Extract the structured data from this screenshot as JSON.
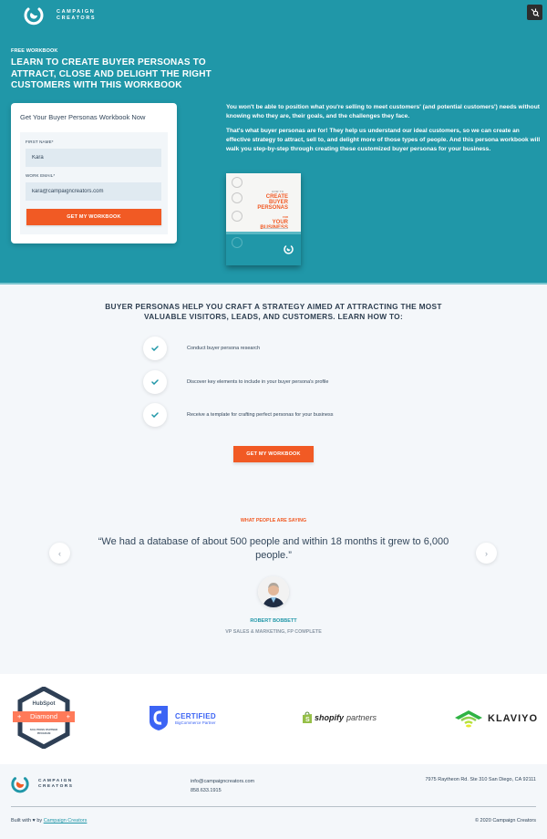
{
  "header": {
    "brand_line1": "CAMPAIGN",
    "brand_line2": "CREATORS",
    "hubspot_badge_icon": "hubspot-sprocket-icon"
  },
  "hero": {
    "eyebrow": "FREE WORKBOOK",
    "title": "LEARN TO CREATE BUYER PERSONAS TO ATTRACT, CLOSE AND DELIGHT THE RIGHT CUSTOMERS WITH THIS WORKBOOK",
    "paragraphs": [
      "You won't be able to position what you're selling to meet customers' (and potential customers') needs without knowing who they are, their goals, and the challenges they face.",
      "That's what buyer personas are for! They help us understand our ideal customers, so we can create an effective strategy to attract, sell to, and delight more of those types of people. And this persona workbook will walk you step-by-step through creating these customized buyer personas for your business."
    ],
    "book": {
      "how_to": "HOW TO",
      "line1": "CREATE",
      "line2": "BUYER",
      "line3": "PERSONAS",
      "for": "FOR",
      "line4": "YOUR",
      "line5": "BUSINESS"
    }
  },
  "form": {
    "title": "Get Your Buyer Personas Workbook Now",
    "first_name_label": "FIRST NAME*",
    "first_name_value": "Kara",
    "email_label": "WORK EMAIL*",
    "email_value": "kara@campaigncreators.com",
    "submit_label": "GET MY WORKBOOK"
  },
  "benefits": {
    "title": "BUYER PERSONAS HELP YOU CRAFT A STRATEGY AIMED AT ATTRACTING THE MOST VALUABLE VISITORS, LEADS, AND CUSTOMERS. LEARN HOW TO:",
    "items": [
      "Conduct buyer persona research",
      "Discover key elements to include in your buyer persona's profile",
      "Receive a template for crafting perfect personas for your business"
    ],
    "cta_label": "GET MY WORKBOOK"
  },
  "testimonial": {
    "eyebrow": "WHAT PEOPLE ARE SAYING",
    "quote": "“We had a database of about 500 people and within 18 months it grew to 6,000 people.”",
    "name": "ROBERT BOBBETT",
    "role": "VP SALES & MARKETING, FP COMPLETE",
    "prev_icon": "chevron-left-icon",
    "next_icon": "chevron-right-icon"
  },
  "partners": {
    "hubspot": {
      "brand": "HubSpot",
      "tier": "Diamond",
      "program_line1": "SOLUTIONS PARTNER",
      "program_line2": "PROGRAM"
    },
    "bigcommerce": {
      "title": "CERTIFIED",
      "subtitle": "BigCommerce Partner"
    },
    "shopify": {
      "bold": "shopify",
      "light": "partners"
    },
    "klaviyo": {
      "name": "KLAVIYO"
    }
  },
  "footer": {
    "brand_line1": "CAMPAIGN",
    "brand_line2": "CREATORS",
    "email": "info@campaigncreators.com",
    "phone": "858.633.1915",
    "address": "7975 Raytheon Rd. Ste 310 San Diego, CA 92111",
    "built_with": "Built with",
    "built_by": "by",
    "built_link": "Campaign Creators",
    "copyright": "© 2020 Campaign Creators"
  },
  "colors": {
    "teal": "#2097a8",
    "orange": "#f15a24",
    "text": "#33475b",
    "page_bg": "#f4f7fa"
  }
}
